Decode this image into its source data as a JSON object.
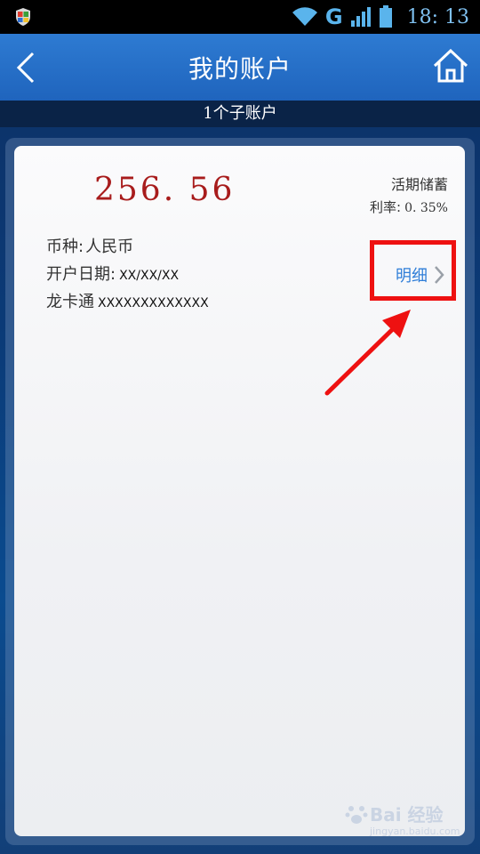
{
  "status_bar": {
    "network": "G",
    "time": "18: 13"
  },
  "header": {
    "title": "我的账户"
  },
  "subheader": {
    "text": "1个子账户"
  },
  "account": {
    "balance": "256. 56",
    "type": "活期储蓄",
    "rate_label": "利率:",
    "rate_value": "0. 35%",
    "currency_label": "币种:",
    "currency_value": "人民币",
    "open_date_label": "开户日期:",
    "open_date_value": "XX/XX/XX",
    "card_label": "龙卡通",
    "card_value": "XXXXXXXXXXXXX",
    "detail_label": "明细"
  },
  "annotation": {
    "highlight_color": "#ee1111"
  },
  "watermark": {
    "main": "Bai 经验",
    "sub": "jingyan.baidu.com"
  },
  "colors": {
    "header_blue": "#2467c2",
    "balance_red": "#a81c1c",
    "link_blue": "#2f7ed8"
  }
}
